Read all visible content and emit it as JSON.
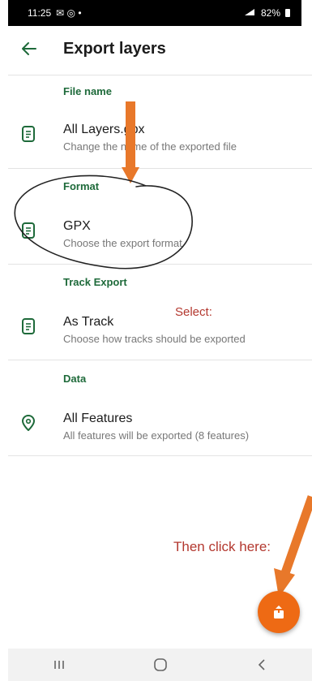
{
  "status_bar": {
    "time": "11:25",
    "left_icons": "✉ ◎ •",
    "battery": "82%"
  },
  "header": {
    "title": "Export layers"
  },
  "sections": [
    {
      "label": "File name",
      "title": "All Layers.gpx",
      "subtitle": "Change the name of the exported file",
      "icon": "file-icon"
    },
    {
      "label": "Format",
      "title": "GPX",
      "subtitle": "Choose the export format",
      "icon": "file-icon"
    },
    {
      "label": "Track Export",
      "title": "As Track",
      "subtitle": "Choose how tracks should be exported",
      "icon": "file-icon"
    },
    {
      "label": "Data",
      "title": "All Features",
      "subtitle": "All features will be exported (8 features)",
      "icon": "location-pin-icon"
    }
  ],
  "annotations": {
    "select": "Select:",
    "click": "Then click here:"
  },
  "colors": {
    "accent_green": "#1e6a3a",
    "fab_orange": "#ee6a14",
    "annotation_red": "#b3382f",
    "arrow_orange": "#e8782a"
  }
}
